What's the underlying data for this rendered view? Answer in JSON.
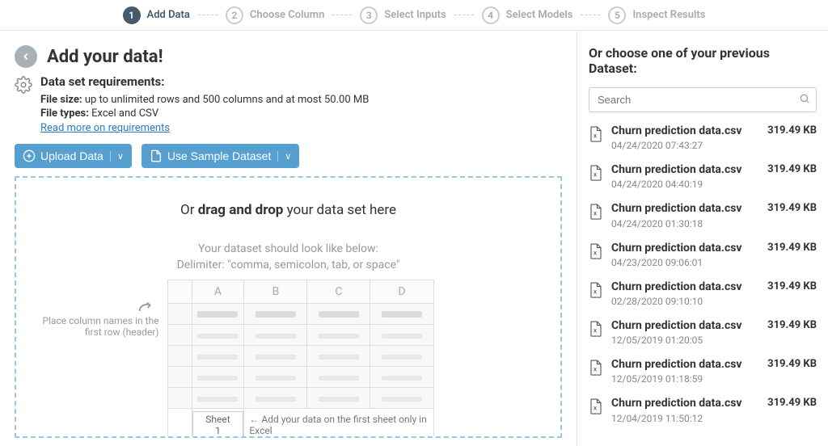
{
  "stepper": {
    "steps": [
      {
        "num": "1",
        "label": "Add Data",
        "active": true
      },
      {
        "num": "2",
        "label": "Choose Column",
        "active": false
      },
      {
        "num": "3",
        "label": "Select Inputs",
        "active": false
      },
      {
        "num": "4",
        "label": "Select Models",
        "active": false
      },
      {
        "num": "5",
        "label": "Inspect Results",
        "active": false
      }
    ]
  },
  "header": {
    "title": "Add your data!"
  },
  "requirements": {
    "title": "Data set requirements:",
    "file_size_label": "File size:",
    "file_size_text": " up to unlimited rows and 500 columns and at most 50.00 MB",
    "file_types_label": "File types:",
    "file_types_text": " Excel and CSV",
    "read_more": "Read more on requirements"
  },
  "buttons": {
    "upload": "Upload Data",
    "sample": "Use Sample Dataset"
  },
  "dropzone": {
    "or": "Or ",
    "dnd": "drag and drop",
    "rest": " your data set here",
    "hint1": "Your dataset should look like below:",
    "hint2": "Delimiter: \"comma, semicolon, tab, or space\"",
    "cols": [
      "A",
      "B",
      "C",
      "D"
    ],
    "header_hint": "Place column names in the first row (header)",
    "sheet_tab": "Sheet 1",
    "sheet_hint": "Add your data on the first sheet only in Excel"
  },
  "right": {
    "title": "Or choose one of your previous Dataset:",
    "search_placeholder": "Search",
    "datasets": [
      {
        "name": "Churn prediction data.csv",
        "date": "04/24/2020 07:43:27",
        "size": "319.49 KB"
      },
      {
        "name": "Churn prediction data.csv",
        "date": "04/24/2020 04:40:19",
        "size": "319.49 KB"
      },
      {
        "name": "Churn prediction data.csv",
        "date": "04/24/2020 01:30:18",
        "size": "319.49 KB"
      },
      {
        "name": "Churn prediction data.csv",
        "date": "04/23/2020 09:06:01",
        "size": "319.49 KB"
      },
      {
        "name": "Churn prediction data.csv",
        "date": "02/28/2020 09:10:10",
        "size": "319.49 KB"
      },
      {
        "name": "Churn prediction data.csv",
        "date": "12/05/2019 01:20:05",
        "size": "319.49 KB"
      },
      {
        "name": "Churn prediction data.csv",
        "date": "12/05/2019 01:18:59",
        "size": "319.49 KB"
      },
      {
        "name": "Churn prediction data.csv",
        "date": "12/04/2019 11:50:12",
        "size": "319.49 KB"
      }
    ]
  }
}
